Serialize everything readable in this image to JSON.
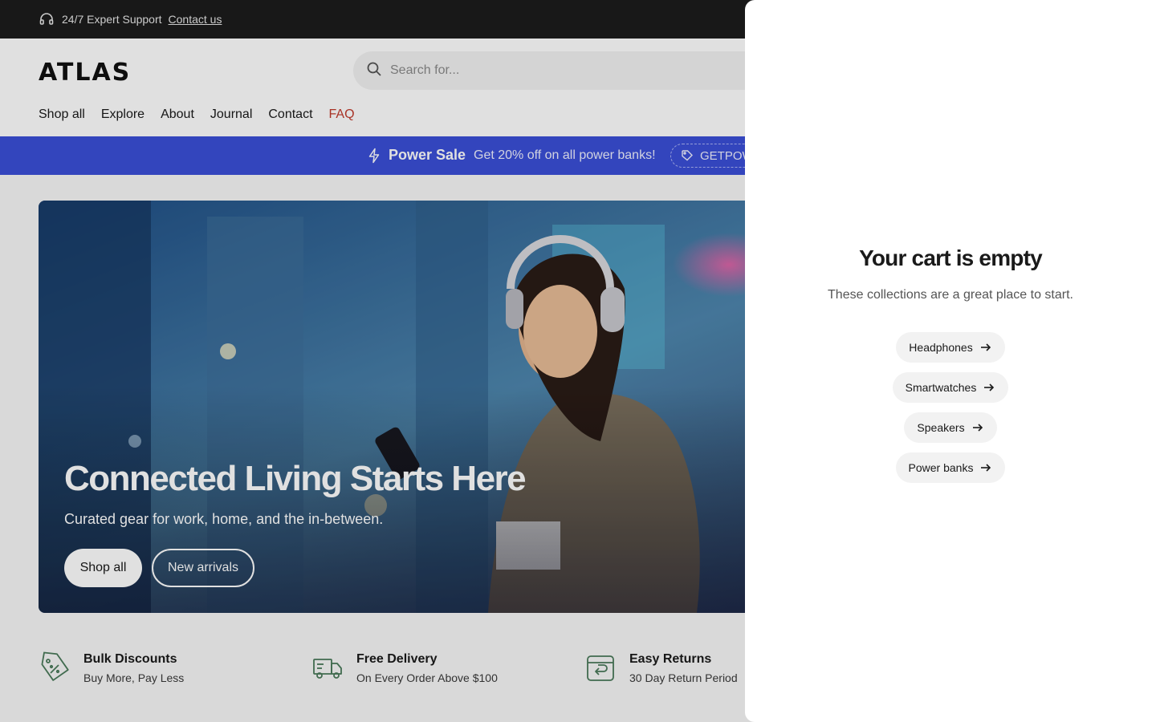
{
  "topbar": {
    "icon": "headset-icon",
    "support_text": "24/7 Expert Support",
    "contact_link": "Contact us"
  },
  "header": {
    "logo_text": "ATLAS",
    "search_placeholder": "Search for...",
    "nav": [
      "Shop all",
      "Explore",
      "About",
      "Journal",
      "Contact",
      "FAQ"
    ],
    "faq_color": "#c0392b"
  },
  "promo": {
    "icon": "bolt-icon",
    "title": "Power Sale",
    "message": "Get 20% off on all power banks!",
    "code": "GETPOW",
    "background": "#3b4fd8"
  },
  "hero": {
    "title": "Connected Living Starts Here",
    "subtitle": "Curated gear for work, home, and the in-between.",
    "primary_button": "Shop all",
    "secondary_button": "New arrivals"
  },
  "features": [
    {
      "icon": "discount-tag-icon",
      "title": "Bulk Discounts",
      "desc": "Buy More, Pay Less"
    },
    {
      "icon": "delivery-truck-icon",
      "title": "Free Delivery",
      "desc": "On Every Order Above $100"
    },
    {
      "icon": "return-box-icon",
      "title": "Easy Returns",
      "desc": "30 Day Return Period"
    }
  ],
  "cart": {
    "title": "Your cart is empty",
    "hint": "These collections are a great place to start.",
    "collections": [
      "Headphones",
      "Smartwatches",
      "Speakers",
      "Power banks"
    ]
  },
  "colors": {
    "topbar_bg": "#1c1c1c",
    "feature_icon": "#4a7a5a",
    "overlay": "rgba(0,0,0,0.12)"
  }
}
